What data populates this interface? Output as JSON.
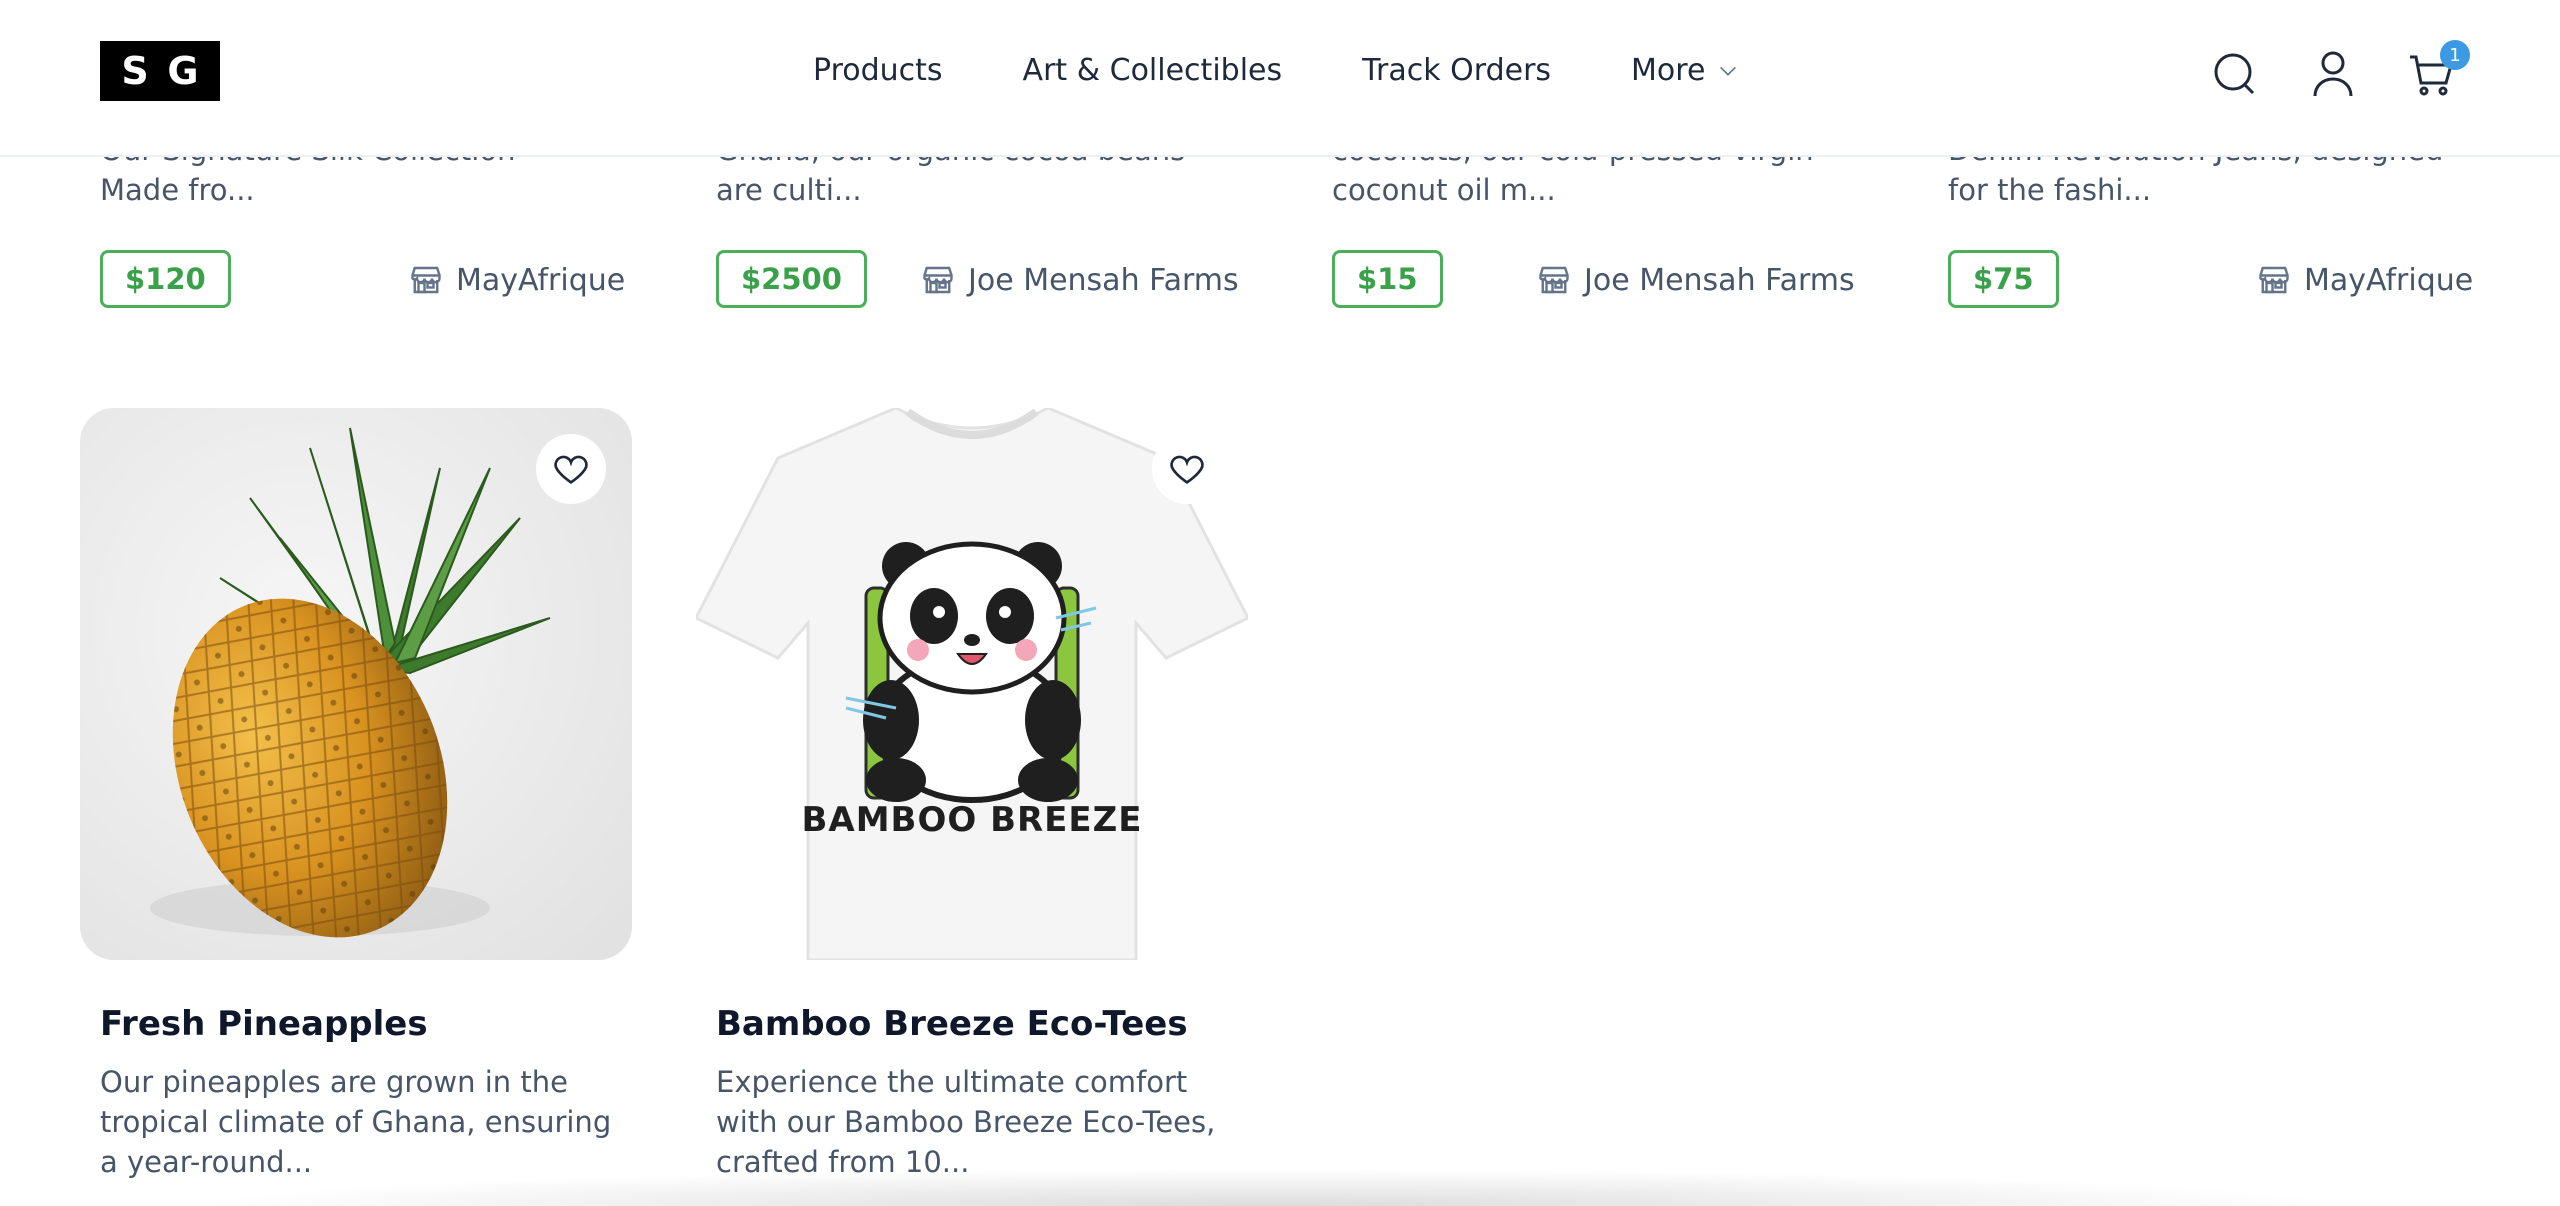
{
  "header": {
    "logo": [
      "S",
      "G"
    ],
    "nav": [
      {
        "label": "Products"
      },
      {
        "label": "Art & Collectibles"
      },
      {
        "label": "Track Orders"
      },
      {
        "label": "More"
      }
    ],
    "icons": [
      "search-icon",
      "user-icon",
      "cart-icon"
    ],
    "cart_count": "1"
  },
  "top_row": [
    {
      "desc_partial": "Our Signature Silk Collection scarves.",
      "desc_end": "Made fro...",
      "price": "$120",
      "vendor": "MayAfrique"
    },
    {
      "desc_partial": "Ghana, our organic cocoa beans",
      "desc_end": "are culti...",
      "price": "$2500",
      "vendor": "Joe Mensah Farms"
    },
    {
      "desc_partial": "coconuts, our cold-pressed virgin",
      "desc_end": "coconut oil m...",
      "price": "$15",
      "vendor": "Joe Mensah Farms"
    },
    {
      "desc_partial": "Denim Revolution Jeans, designed",
      "desc_end": "for the fashi...",
      "price": "$75",
      "vendor": "MayAfrique"
    }
  ],
  "products": [
    {
      "title": "Fresh Pineapples",
      "desc": "Our pineapples are grown in the tropical climate of Ghana, ensuring a year-round..."
    },
    {
      "title": "Bamboo Breeze Eco-Tees",
      "desc": "Experience the ultimate comfort with our Bamboo Breeze Eco-Tees, crafted from 10...",
      "tee_print": "BAMBOO BREEZE"
    }
  ],
  "colors": {
    "price_green": "#3aa14a",
    "badge_blue": "#3b9ae1",
    "text_dark": "#0f172a",
    "text_muted": "#475569"
  }
}
